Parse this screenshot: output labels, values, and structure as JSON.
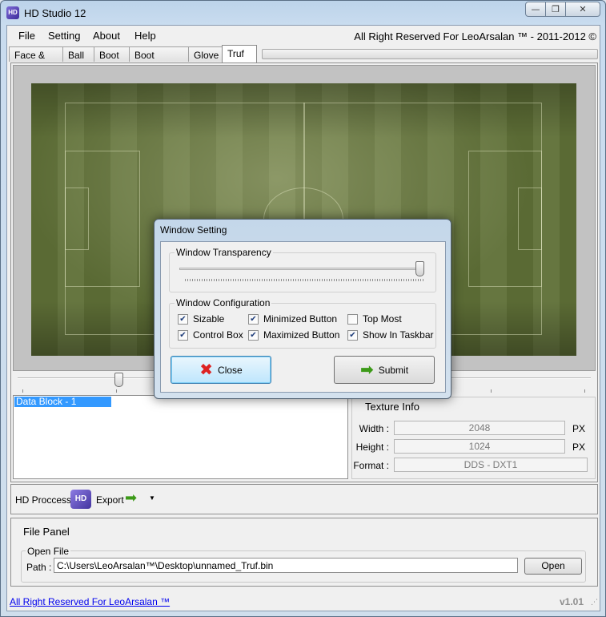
{
  "window": {
    "title": "HD Studio 12",
    "icon_label": "HD"
  },
  "window_buttons": {
    "minimize": "—",
    "restore": "❐",
    "close": "✕"
  },
  "menu": {
    "items": [
      "File",
      "Setting",
      "About",
      "Help"
    ],
    "copyright": "All Right Reserved For LeoArsalan ™ - 2011-2012 ©"
  },
  "tabs": [
    "Face & Hair",
    "Ball",
    "Boot",
    "Boot Perview",
    "Glove",
    "Truf"
  ],
  "data_block": {
    "selected_item": "Data Block - 1"
  },
  "texture_info": {
    "title": "Texture Info",
    "width_label": "Width :",
    "width_value": "2048",
    "height_label": "Height :",
    "height_value": "1024",
    "format_label": "Format :",
    "format_value": "DDS - DXT1",
    "unit": "PX"
  },
  "hd_panel": {
    "process_label": "HD Proccess",
    "export_label": "Export",
    "icon_label": "HD"
  },
  "file_panel": {
    "title": "File Panel",
    "group_label": "Open File",
    "path_label": "Path :",
    "path_value": "C:\\Users\\LeoArsalan™\\Desktop\\unnamed_Truf.bin",
    "open_button": "Open"
  },
  "footer": {
    "link": "All Right Reserved For LeoArsalan ™",
    "version": "v1.01"
  },
  "dialog": {
    "title": "Window Setting",
    "transparency_group": "Window Transparency",
    "transparency_level": 1.0,
    "config_group": "Window Configuration",
    "options": {
      "sizable": {
        "label": "Sizable",
        "checked": true
      },
      "minimized_button": {
        "label": "Minimized Button",
        "checked": true
      },
      "top_most": {
        "label": "Top Most",
        "checked": false
      },
      "control_box": {
        "label": "Control Box",
        "checked": true
      },
      "maximized_button": {
        "label": "Maximized Button",
        "checked": true
      },
      "show_in_taskbar": {
        "label": "Show In Taskbar",
        "checked": true
      }
    },
    "close_button": "Close",
    "submit_button": "Submit"
  },
  "colors": {
    "selection": "#3399ff",
    "link": "#0000ee",
    "close_icon": "#dd2222",
    "submit_icon": "#3c9a18"
  }
}
